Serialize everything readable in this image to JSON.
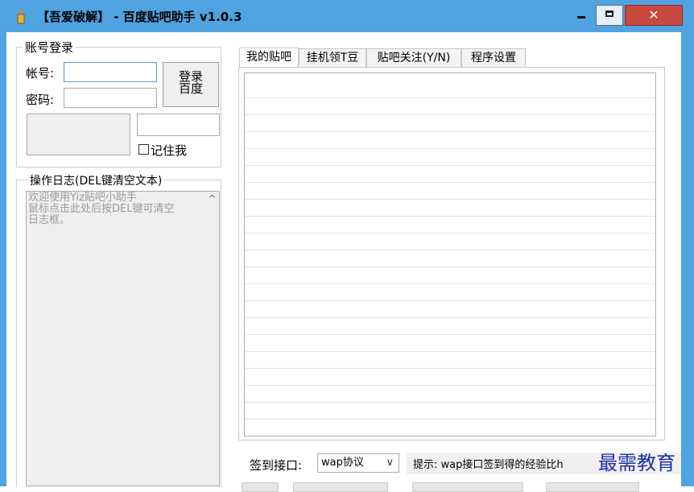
{
  "window": {
    "title": "【吾爱破解】 - 百度贴吧助手 v1.0.3",
    "close_glyph": "✕",
    "icon": "candle-icon",
    "accent": "#4fa3e0",
    "close_color": "#c9483f"
  },
  "login": {
    "group_title": "账号登录",
    "account_label": "帐号:",
    "account_value": "",
    "password_label": "密码:",
    "password_value": "",
    "login_button_line1": "登录",
    "login_button_line2": "百度",
    "captcha_value": "",
    "remember_label": "记住我",
    "remember_checked": false
  },
  "log": {
    "group_title": "操作日志(DEL键清空文本)",
    "text": "欢迎使用Yiz贴吧小助手\n鼠标点击此处后按DEL键可清空\n日志框。"
  },
  "tabs": [
    {
      "label": "我的贴吧",
      "active": true
    },
    {
      "label": "挂机领T豆",
      "active": false
    },
    {
      "label": "贴吧关注(Y/N)",
      "active": false
    },
    {
      "label": "程序设置",
      "active": false
    }
  ],
  "bottom": {
    "sign_label": "签到接口:",
    "sign_select": "wap协议",
    "hint": "提示: wap接口签到得的经验比h"
  },
  "watermark": "最需教育"
}
